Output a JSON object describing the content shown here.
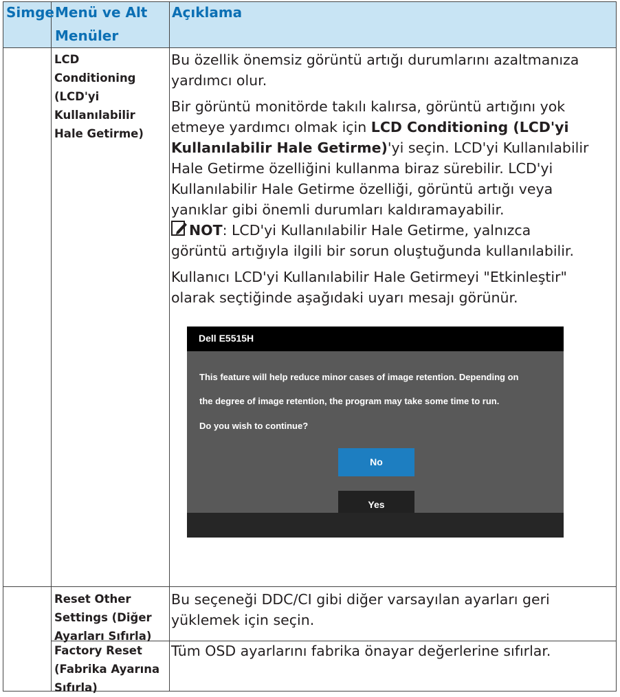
{
  "header": {
    "col1": "Simge",
    "col2_line1": "Menü ve Alt",
    "col2_line2": "Menüler",
    "col3": "Açıklama"
  },
  "rows": [
    {
      "menu_lines": [
        "LCD",
        "Conditioning",
        "(LCD'yi",
        "Kullanılabilir",
        "Hale Getirme)"
      ],
      "paragraphs": {
        "p1_l1": "Bu özellik önemsiz görüntü artığı durumlarını azaltmanıza",
        "p1_l2": "yardımcı olur.",
        "p2_l1": "Bir görüntü monitörde takılı kalırsa, görüntü artığını yok",
        "p2_l2_pre": "etmeye yardımcı olmak için ",
        "p2_l2_bold": "LCD Conditioning (LCD'yi",
        "p2_l3_bold": "Kullanılabilir Hale Getirme)",
        "p2_l3_post": "'yi seçin. LCD'yi Kullanılabilir",
        "p2_l4": "Hale Getirme özelliğini kullanma biraz sürebilir. LCD'yi",
        "p2_l5": "Kullanılabilir Hale Getirme özelliği, görüntü artığı veya",
        "p2_l6": "yanıklar gibi önemli durumları kaldıramayabilir.",
        "note_label": "NOT",
        "note_l1": ": LCD'yi Kullanılabilir Hale Getirme, yalnızca",
        "note_l2": "görüntü artığıyla ilgili bir sorun oluştuğunda kullanılabilir.",
        "p3_l1": "Kullanıcı LCD'yi Kullanılabilir Hale Getirmeyi \"Etkinleştir\"",
        "p3_l2": "olarak seçtiğinde aşağıdaki uyarı mesajı görünür."
      },
      "note_icon": "pencil-note-icon"
    },
    {
      "menu_lines": [
        "Reset Other",
        "Settings (Diğer",
        "Ayarları Sıfırla)"
      ],
      "desc_l1": "Bu seçeneği DDC/CI gibi diğer varsayılan ayarları geri",
      "desc_l2": "yüklemek için seçin."
    },
    {
      "menu_lines": [
        "Factory Reset",
        "(Fabrika Ayarına",
        "Sıfırla)"
      ],
      "desc_l1": "Tüm OSD ayarlarını fabrika önayar değerlerine sıfırlar."
    }
  ],
  "dialog": {
    "title": "Dell E5515H",
    "msg_l1": "This feature will help reduce minor cases of image retention. Depending on",
    "msg_l2": "the degree of image retention, the program may take some time to run.",
    "msg_l3": "Do you wish to continue?",
    "no_label": "No",
    "yes_label": "Yes"
  },
  "colors": {
    "header_bg": "#c8e4f4",
    "header_text": "#0b6fb4",
    "dialog_bg": "#595959",
    "no_button": "#1d7ec1",
    "yes_button": "#212121"
  }
}
